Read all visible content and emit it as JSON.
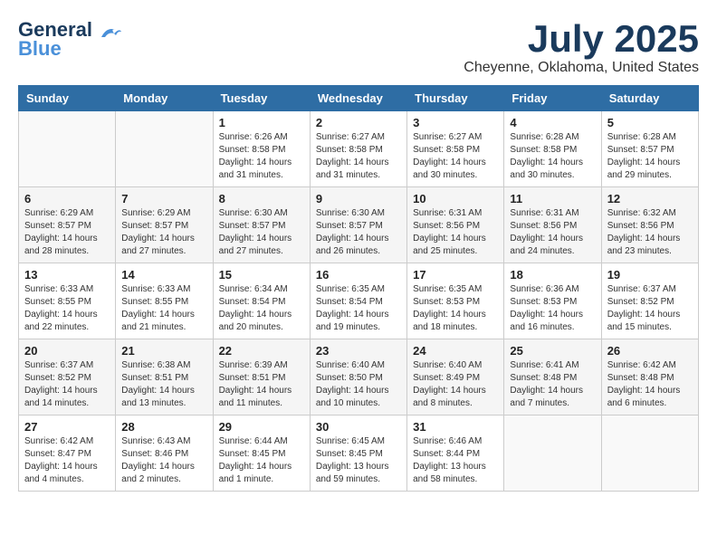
{
  "header": {
    "logo_line1": "General",
    "logo_line2": "Blue",
    "month_year": "July 2025",
    "location": "Cheyenne, Oklahoma, United States"
  },
  "weekdays": [
    "Sunday",
    "Monday",
    "Tuesday",
    "Wednesday",
    "Thursday",
    "Friday",
    "Saturday"
  ],
  "weeks": [
    [
      {
        "day": "",
        "sunrise": "",
        "sunset": "",
        "daylight": ""
      },
      {
        "day": "",
        "sunrise": "",
        "sunset": "",
        "daylight": ""
      },
      {
        "day": "1",
        "sunrise": "Sunrise: 6:26 AM",
        "sunset": "Sunset: 8:58 PM",
        "daylight": "Daylight: 14 hours and 31 minutes."
      },
      {
        "day": "2",
        "sunrise": "Sunrise: 6:27 AM",
        "sunset": "Sunset: 8:58 PM",
        "daylight": "Daylight: 14 hours and 31 minutes."
      },
      {
        "day": "3",
        "sunrise": "Sunrise: 6:27 AM",
        "sunset": "Sunset: 8:58 PM",
        "daylight": "Daylight: 14 hours and 30 minutes."
      },
      {
        "day": "4",
        "sunrise": "Sunrise: 6:28 AM",
        "sunset": "Sunset: 8:58 PM",
        "daylight": "Daylight: 14 hours and 30 minutes."
      },
      {
        "day": "5",
        "sunrise": "Sunrise: 6:28 AM",
        "sunset": "Sunset: 8:57 PM",
        "daylight": "Daylight: 14 hours and 29 minutes."
      }
    ],
    [
      {
        "day": "6",
        "sunrise": "Sunrise: 6:29 AM",
        "sunset": "Sunset: 8:57 PM",
        "daylight": "Daylight: 14 hours and 28 minutes."
      },
      {
        "day": "7",
        "sunrise": "Sunrise: 6:29 AM",
        "sunset": "Sunset: 8:57 PM",
        "daylight": "Daylight: 14 hours and 27 minutes."
      },
      {
        "day": "8",
        "sunrise": "Sunrise: 6:30 AM",
        "sunset": "Sunset: 8:57 PM",
        "daylight": "Daylight: 14 hours and 27 minutes."
      },
      {
        "day": "9",
        "sunrise": "Sunrise: 6:30 AM",
        "sunset": "Sunset: 8:57 PM",
        "daylight": "Daylight: 14 hours and 26 minutes."
      },
      {
        "day": "10",
        "sunrise": "Sunrise: 6:31 AM",
        "sunset": "Sunset: 8:56 PM",
        "daylight": "Daylight: 14 hours and 25 minutes."
      },
      {
        "day": "11",
        "sunrise": "Sunrise: 6:31 AM",
        "sunset": "Sunset: 8:56 PM",
        "daylight": "Daylight: 14 hours and 24 minutes."
      },
      {
        "day": "12",
        "sunrise": "Sunrise: 6:32 AM",
        "sunset": "Sunset: 8:56 PM",
        "daylight": "Daylight: 14 hours and 23 minutes."
      }
    ],
    [
      {
        "day": "13",
        "sunrise": "Sunrise: 6:33 AM",
        "sunset": "Sunset: 8:55 PM",
        "daylight": "Daylight: 14 hours and 22 minutes."
      },
      {
        "day": "14",
        "sunrise": "Sunrise: 6:33 AM",
        "sunset": "Sunset: 8:55 PM",
        "daylight": "Daylight: 14 hours and 21 minutes."
      },
      {
        "day": "15",
        "sunrise": "Sunrise: 6:34 AM",
        "sunset": "Sunset: 8:54 PM",
        "daylight": "Daylight: 14 hours and 20 minutes."
      },
      {
        "day": "16",
        "sunrise": "Sunrise: 6:35 AM",
        "sunset": "Sunset: 8:54 PM",
        "daylight": "Daylight: 14 hours and 19 minutes."
      },
      {
        "day": "17",
        "sunrise": "Sunrise: 6:35 AM",
        "sunset": "Sunset: 8:53 PM",
        "daylight": "Daylight: 14 hours and 18 minutes."
      },
      {
        "day": "18",
        "sunrise": "Sunrise: 6:36 AM",
        "sunset": "Sunset: 8:53 PM",
        "daylight": "Daylight: 14 hours and 16 minutes."
      },
      {
        "day": "19",
        "sunrise": "Sunrise: 6:37 AM",
        "sunset": "Sunset: 8:52 PM",
        "daylight": "Daylight: 14 hours and 15 minutes."
      }
    ],
    [
      {
        "day": "20",
        "sunrise": "Sunrise: 6:37 AM",
        "sunset": "Sunset: 8:52 PM",
        "daylight": "Daylight: 14 hours and 14 minutes."
      },
      {
        "day": "21",
        "sunrise": "Sunrise: 6:38 AM",
        "sunset": "Sunset: 8:51 PM",
        "daylight": "Daylight: 14 hours and 13 minutes."
      },
      {
        "day": "22",
        "sunrise": "Sunrise: 6:39 AM",
        "sunset": "Sunset: 8:51 PM",
        "daylight": "Daylight: 14 hours and 11 minutes."
      },
      {
        "day": "23",
        "sunrise": "Sunrise: 6:40 AM",
        "sunset": "Sunset: 8:50 PM",
        "daylight": "Daylight: 14 hours and 10 minutes."
      },
      {
        "day": "24",
        "sunrise": "Sunrise: 6:40 AM",
        "sunset": "Sunset: 8:49 PM",
        "daylight": "Daylight: 14 hours and 8 minutes."
      },
      {
        "day": "25",
        "sunrise": "Sunrise: 6:41 AM",
        "sunset": "Sunset: 8:48 PM",
        "daylight": "Daylight: 14 hours and 7 minutes."
      },
      {
        "day": "26",
        "sunrise": "Sunrise: 6:42 AM",
        "sunset": "Sunset: 8:48 PM",
        "daylight": "Daylight: 14 hours and 6 minutes."
      }
    ],
    [
      {
        "day": "27",
        "sunrise": "Sunrise: 6:42 AM",
        "sunset": "Sunset: 8:47 PM",
        "daylight": "Daylight: 14 hours and 4 minutes."
      },
      {
        "day": "28",
        "sunrise": "Sunrise: 6:43 AM",
        "sunset": "Sunset: 8:46 PM",
        "daylight": "Daylight: 14 hours and 2 minutes."
      },
      {
        "day": "29",
        "sunrise": "Sunrise: 6:44 AM",
        "sunset": "Sunset: 8:45 PM",
        "daylight": "Daylight: 14 hours and 1 minute."
      },
      {
        "day": "30",
        "sunrise": "Sunrise: 6:45 AM",
        "sunset": "Sunset: 8:45 PM",
        "daylight": "Daylight: 13 hours and 59 minutes."
      },
      {
        "day": "31",
        "sunrise": "Sunrise: 6:46 AM",
        "sunset": "Sunset: 8:44 PM",
        "daylight": "Daylight: 13 hours and 58 minutes."
      },
      {
        "day": "",
        "sunrise": "",
        "sunset": "",
        "daylight": ""
      },
      {
        "day": "",
        "sunrise": "",
        "sunset": "",
        "daylight": ""
      }
    ]
  ]
}
